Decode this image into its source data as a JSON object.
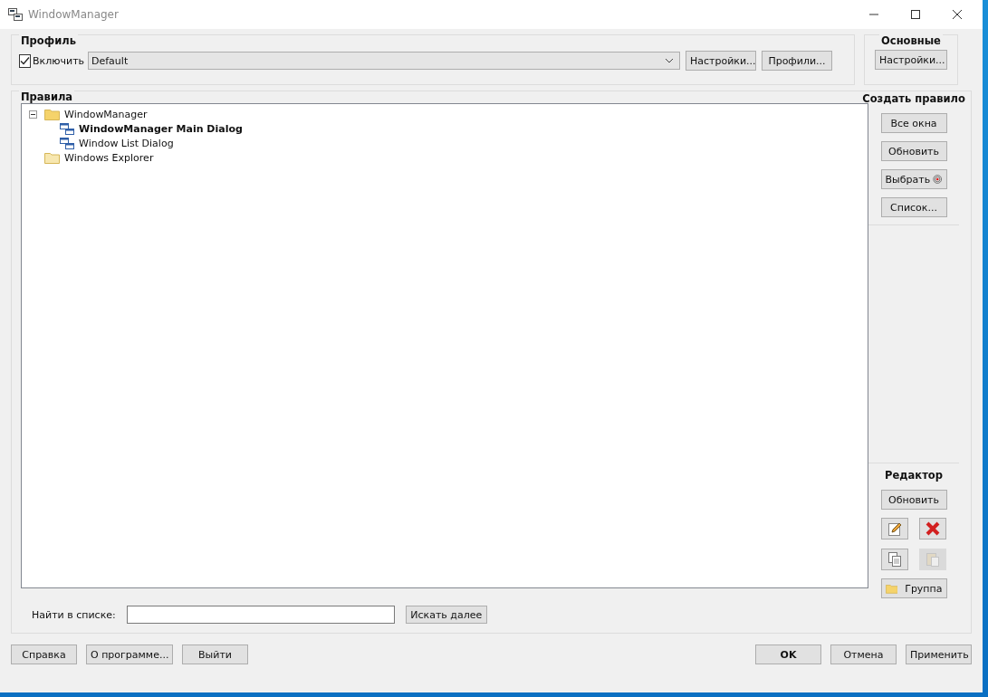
{
  "window": {
    "title": "WindowManager"
  },
  "profile": {
    "title": "Профиль",
    "enable": {
      "label": "Включить",
      "checked": true
    },
    "dropdown": {
      "value": "Default"
    },
    "buttons": [
      "Настройки...",
      "Профили..."
    ]
  },
  "general": {
    "title": "Основные",
    "button": "Настройки..."
  },
  "rules": {
    "title": "Правила",
    "tree": [
      {
        "label": "WindowManager",
        "kind": "folder",
        "expanded": true,
        "bold": false,
        "children": [
          {
            "label": "WindowManager Main Dialog",
            "kind": "window",
            "bold": true
          },
          {
            "label": "Window List Dialog",
            "kind": "window",
            "bold": false
          }
        ]
      },
      {
        "label": "Windows Explorer",
        "kind": "folder",
        "bold": false
      }
    ],
    "search": {
      "label": "Найти в списке:",
      "button": "Искать далее"
    }
  },
  "create_rule": {
    "title": "Создать правило",
    "buttons": [
      {
        "label": "Все окна",
        "kind": "text"
      },
      {
        "label": "Обновить",
        "kind": "text"
      },
      {
        "label": "Выбрать",
        "kind": "target"
      },
      {
        "label": "Список...",
        "kind": "text"
      }
    ]
  },
  "editor": {
    "title": "Редактор",
    "refresh": "Обновить",
    "tools": [
      {
        "kind": "edit",
        "disabled": false
      },
      {
        "kind": "delete",
        "disabled": false
      },
      {
        "kind": "copy",
        "disabled": false
      },
      {
        "kind": "paste",
        "disabled": true
      }
    ],
    "group": "Группа"
  },
  "footer": {
    "left": [
      "Справка",
      "О программе...",
      "Выйти"
    ],
    "right": [
      {
        "label": "OK",
        "bold": true
      },
      {
        "label": "Отмена",
        "bold": false
      },
      {
        "label": "Применить",
        "bold": false
      }
    ]
  }
}
